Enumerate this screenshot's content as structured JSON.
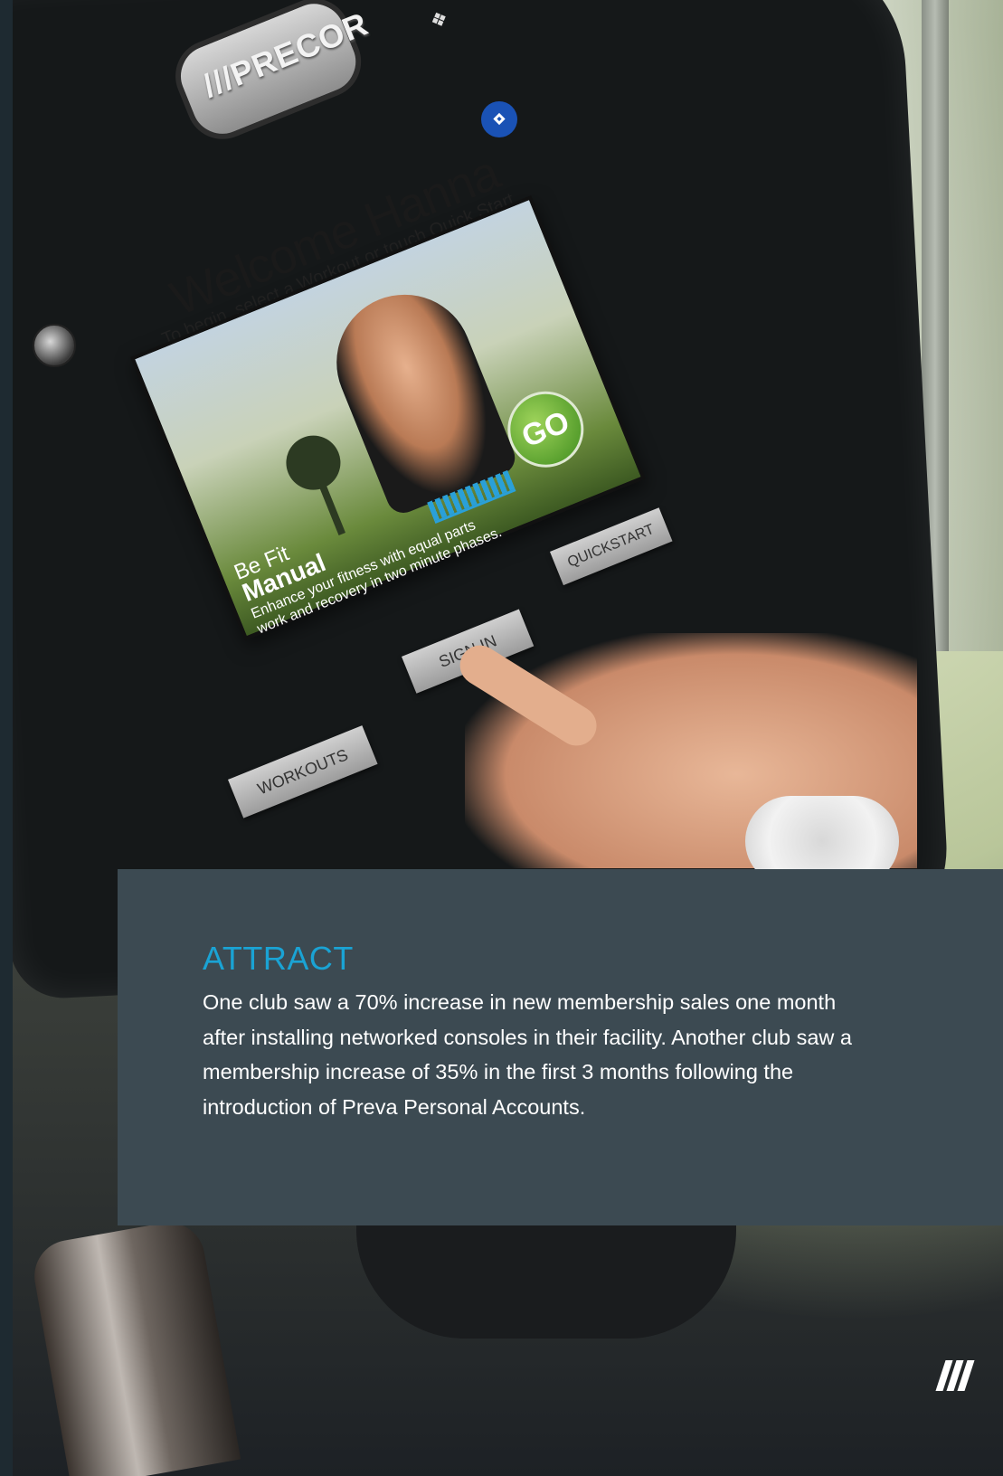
{
  "console": {
    "brand_logo": "///PRECOR",
    "welcome_title": "Welcome Hanna",
    "welcome_subtitle": "To begin, select a Workout or touch Quick Start",
    "featured_workout": {
      "category": "Be Fit",
      "name": "Manual",
      "description": "Enhance your fitness with equal parts work and recovery in two minute phases."
    },
    "go_label": "GO",
    "buttons": {
      "workouts": "WORKOUTS",
      "sign_in": "SIGN IN",
      "quickstart": "QUICKSTART"
    },
    "icons": [
      "wireless-sensor-icon",
      "bluetooth-icon",
      "globe-icon"
    ]
  },
  "callout": {
    "heading": "ATTRACT",
    "body": "One club saw a 70% increase in new membership sales one month after installing networked consoles in their facility. Another club saw a membership increase of 35% in the first 3 months following the introduction of Preva Personal Accounts."
  },
  "colors": {
    "panel_bg": "#3c4a52",
    "heading_accent": "#1aa3d4",
    "go_green": "#4f9b26",
    "bluetooth_blue": "#1a52b5"
  },
  "footer": {
    "brand_mark_icon": "precor-mark-icon"
  }
}
